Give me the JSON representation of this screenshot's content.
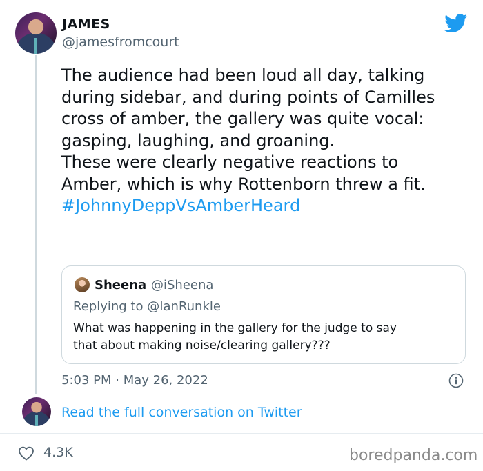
{
  "author": {
    "display_name": "JAMES",
    "handle": "@jamesfromcourt"
  },
  "tweet": {
    "paragraphs": [
      "The audience had been loud all day, talking\nduring sidebar, and during points of Camilles\ncross of amber, the gallery was quite vocal:\ngasping, laughing, and groaning.",
      "These were clearly negative reactions to\nAmber, which is why Rottenborn threw a fit."
    ],
    "hashtag": "#JohnnyDeppVsAmberHeard",
    "timestamp": "5:03 PM · May 26, 2022"
  },
  "quoted_tweet": {
    "display_name": "Sheena",
    "handle": "@iSheena",
    "replying_to": "Replying to @IanRunkle",
    "text": "What was happening in the gallery for the judge to say\nthat about making noise/clearing gallery???"
  },
  "footer": {
    "read_link": "Read the full conversation on Twitter",
    "like_count": "4.3K",
    "watermark": "boredpanda.com"
  },
  "colors": {
    "accent": "#1d9bf0",
    "secondary_text": "#536471",
    "border": "#cfd9de"
  },
  "icons": [
    "twitter-bird-icon",
    "info-icon",
    "heart-icon"
  ]
}
